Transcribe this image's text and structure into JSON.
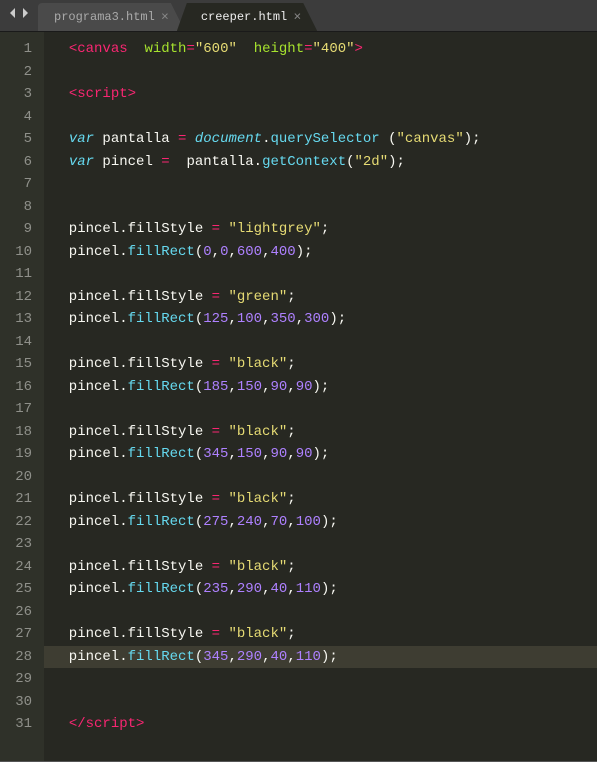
{
  "titlebar": {
    "tabs": [
      {
        "label": "programa3.html",
        "active": false
      },
      {
        "label": "creeper.html",
        "active": true
      }
    ]
  },
  "editor": {
    "lineCount": 31,
    "currentLine": 28,
    "lines": [
      [
        [
          "t-plain",
          "  "
        ],
        [
          "t-tag",
          "<"
        ],
        [
          "t-tag",
          "canvas"
        ],
        [
          "t-plain",
          "  "
        ],
        [
          "t-attr",
          "width"
        ],
        [
          "t-op",
          "="
        ],
        [
          "t-str",
          "\"600\""
        ],
        [
          "t-plain",
          "  "
        ],
        [
          "t-attr",
          "height"
        ],
        [
          "t-op",
          "="
        ],
        [
          "t-str",
          "\"400\""
        ],
        [
          "t-tag",
          ">"
        ]
      ],
      [],
      [
        [
          "t-plain",
          "  "
        ],
        [
          "t-tag",
          "<"
        ],
        [
          "t-tag",
          "script"
        ],
        [
          "t-tag",
          ">"
        ]
      ],
      [],
      [
        [
          "t-plain",
          "  "
        ],
        [
          "t-kw",
          "var"
        ],
        [
          "t-plain",
          " pantalla "
        ],
        [
          "t-store",
          "="
        ],
        [
          "t-plain",
          " "
        ],
        [
          "t-builtin",
          "document"
        ],
        [
          "t-plain",
          "."
        ],
        [
          "t-func",
          "querySelector"
        ],
        [
          "t-plain",
          " ("
        ],
        [
          "t-str",
          "\"canvas\""
        ],
        [
          "t-plain",
          ");"
        ]
      ],
      [
        [
          "t-plain",
          "  "
        ],
        [
          "t-kw",
          "var"
        ],
        [
          "t-plain",
          " pincel "
        ],
        [
          "t-store",
          "="
        ],
        [
          "t-plain",
          "  pantalla."
        ],
        [
          "t-func",
          "getContext"
        ],
        [
          "t-plain",
          "("
        ],
        [
          "t-str",
          "\"2d\""
        ],
        [
          "t-plain",
          ");"
        ]
      ],
      [],
      [],
      [
        [
          "t-plain",
          "  pincel.fillStyle "
        ],
        [
          "t-store",
          "="
        ],
        [
          "t-plain",
          " "
        ],
        [
          "t-str",
          "\"lightgrey\""
        ],
        [
          "t-plain",
          ";"
        ]
      ],
      [
        [
          "t-plain",
          "  pincel."
        ],
        [
          "t-func",
          "fillRect"
        ],
        [
          "t-plain",
          "("
        ],
        [
          "t-num",
          "0"
        ],
        [
          "t-plain",
          ","
        ],
        [
          "t-num",
          "0"
        ],
        [
          "t-plain",
          ","
        ],
        [
          "t-num",
          "600"
        ],
        [
          "t-plain",
          ","
        ],
        [
          "t-num",
          "400"
        ],
        [
          "t-plain",
          ");"
        ]
      ],
      [],
      [
        [
          "t-plain",
          "  pincel.fillStyle "
        ],
        [
          "t-store",
          "="
        ],
        [
          "t-plain",
          " "
        ],
        [
          "t-str",
          "\"green\""
        ],
        [
          "t-plain",
          ";"
        ]
      ],
      [
        [
          "t-plain",
          "  pincel."
        ],
        [
          "t-func",
          "fillRect"
        ],
        [
          "t-plain",
          "("
        ],
        [
          "t-num",
          "125"
        ],
        [
          "t-plain",
          ","
        ],
        [
          "t-num",
          "100"
        ],
        [
          "t-plain",
          ","
        ],
        [
          "t-num",
          "350"
        ],
        [
          "t-plain",
          ","
        ],
        [
          "t-num",
          "300"
        ],
        [
          "t-plain",
          ");"
        ]
      ],
      [],
      [
        [
          "t-plain",
          "  pincel.fillStyle "
        ],
        [
          "t-store",
          "="
        ],
        [
          "t-plain",
          " "
        ],
        [
          "t-str",
          "\"black\""
        ],
        [
          "t-plain",
          ";"
        ]
      ],
      [
        [
          "t-plain",
          "  pincel."
        ],
        [
          "t-func",
          "fillRect"
        ],
        [
          "t-plain",
          "("
        ],
        [
          "t-num",
          "185"
        ],
        [
          "t-plain",
          ","
        ],
        [
          "t-num",
          "150"
        ],
        [
          "t-plain",
          ","
        ],
        [
          "t-num",
          "90"
        ],
        [
          "t-plain",
          ","
        ],
        [
          "t-num",
          "90"
        ],
        [
          "t-plain",
          ");"
        ]
      ],
      [],
      [
        [
          "t-plain",
          "  pincel.fillStyle "
        ],
        [
          "t-store",
          "="
        ],
        [
          "t-plain",
          " "
        ],
        [
          "t-str",
          "\"black\""
        ],
        [
          "t-plain",
          ";"
        ]
      ],
      [
        [
          "t-plain",
          "  pincel."
        ],
        [
          "t-func",
          "fillRect"
        ],
        [
          "t-plain",
          "("
        ],
        [
          "t-num",
          "345"
        ],
        [
          "t-plain",
          ","
        ],
        [
          "t-num",
          "150"
        ],
        [
          "t-plain",
          ","
        ],
        [
          "t-num",
          "90"
        ],
        [
          "t-plain",
          ","
        ],
        [
          "t-num",
          "90"
        ],
        [
          "t-plain",
          ");"
        ]
      ],
      [],
      [
        [
          "t-plain",
          "  pincel.fillStyle "
        ],
        [
          "t-store",
          "="
        ],
        [
          "t-plain",
          " "
        ],
        [
          "t-str",
          "\"black\""
        ],
        [
          "t-plain",
          ";"
        ]
      ],
      [
        [
          "t-plain",
          "  pincel."
        ],
        [
          "t-func",
          "fillRect"
        ],
        [
          "t-plain",
          "("
        ],
        [
          "t-num",
          "275"
        ],
        [
          "t-plain",
          ","
        ],
        [
          "t-num",
          "240"
        ],
        [
          "t-plain",
          ","
        ],
        [
          "t-num",
          "70"
        ],
        [
          "t-plain",
          ","
        ],
        [
          "t-num",
          "100"
        ],
        [
          "t-plain",
          ");"
        ]
      ],
      [],
      [
        [
          "t-plain",
          "  pincel.fillStyle "
        ],
        [
          "t-store",
          "="
        ],
        [
          "t-plain",
          " "
        ],
        [
          "t-str",
          "\"black\""
        ],
        [
          "t-plain",
          ";"
        ]
      ],
      [
        [
          "t-plain",
          "  pincel."
        ],
        [
          "t-func",
          "fillRect"
        ],
        [
          "t-plain",
          "("
        ],
        [
          "t-num",
          "235"
        ],
        [
          "t-plain",
          ","
        ],
        [
          "t-num",
          "290"
        ],
        [
          "t-plain",
          ","
        ],
        [
          "t-num",
          "40"
        ],
        [
          "t-plain",
          ","
        ],
        [
          "t-num",
          "110"
        ],
        [
          "t-plain",
          ");"
        ]
      ],
      [],
      [
        [
          "t-plain",
          "  pincel.fillStyle "
        ],
        [
          "t-store",
          "="
        ],
        [
          "t-plain",
          " "
        ],
        [
          "t-str",
          "\"black\""
        ],
        [
          "t-plain",
          ";"
        ]
      ],
      [
        [
          "t-plain",
          "  pincel."
        ],
        [
          "t-func",
          "fillRect"
        ],
        [
          "t-plain",
          "("
        ],
        [
          "t-num",
          "345"
        ],
        [
          "t-plain",
          ","
        ],
        [
          "t-num",
          "290"
        ],
        [
          "t-plain",
          ","
        ],
        [
          "t-num",
          "40"
        ],
        [
          "t-plain",
          ","
        ],
        [
          "t-num",
          "110"
        ],
        [
          "t-plain",
          ");"
        ]
      ],
      [],
      [],
      [
        [
          "t-plain",
          "  "
        ],
        [
          "t-tag",
          "</"
        ],
        [
          "t-tag",
          "script"
        ],
        [
          "t-tag",
          ">"
        ]
      ]
    ]
  }
}
